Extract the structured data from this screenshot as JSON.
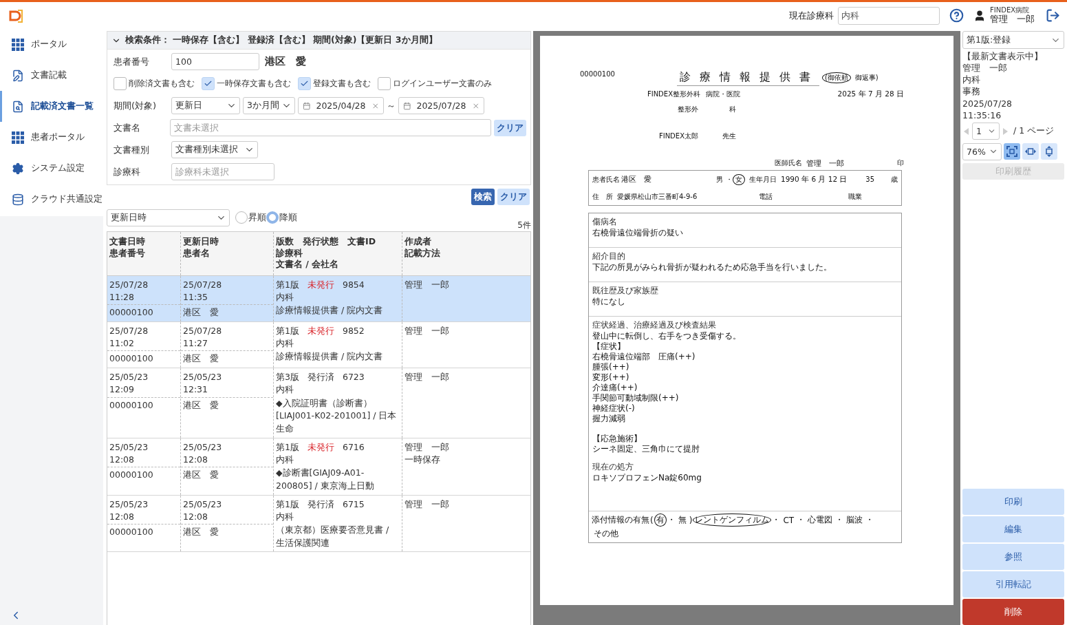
{
  "header": {
    "dept_label": "現在診療科",
    "dept_value": "内科",
    "hospital": "FINDEX病院",
    "user": "管理　一郎"
  },
  "sidebar": {
    "items": [
      {
        "label": "ポータル",
        "selected": false
      },
      {
        "label": "文書記載",
        "selected": false
      },
      {
        "label": "記載済文書一覧",
        "selected": true
      },
      {
        "label": "患者ポータル",
        "selected": false
      },
      {
        "label": "システム設定",
        "selected": false
      },
      {
        "label": "クラウド共通設定",
        "selected": false
      }
    ]
  },
  "search": {
    "expanded": true,
    "summary": "検索条件： 一時保存【含む】 登録済【含む】 期間(対象)【更新日 3か月間】",
    "patient_number_label": "患者番号",
    "patient_number": "100",
    "patient_name": "港区　愛",
    "checkboxes": [
      {
        "label": "削除済文書も含む",
        "checked": false
      },
      {
        "label": "一時保存文書も含む",
        "checked": true
      },
      {
        "label": "登録文書も含む",
        "checked": true
      },
      {
        "label": "ログインユーザー文書のみ",
        "checked": false
      }
    ],
    "period_label": "期間(対象)",
    "period_field": "更新日",
    "period_range": "3か月間",
    "date_from": "2025/04/28",
    "range_separator": "～",
    "date_to": "2025/07/28",
    "doc_name_label": "文書名",
    "doc_name_placeholder": "文書未選択",
    "doc_name_clear": "クリア",
    "doc_type_label": "文書種別",
    "doc_type_value": "文書種別未選択",
    "dept_label": "診療科",
    "dept_placeholder": "診療科未選択"
  },
  "actions": {
    "search": "検索",
    "clear": "クリア"
  },
  "sort": {
    "field": "更新日時",
    "orders": [
      {
        "label": "昇順",
        "selected": false
      },
      {
        "label": "降順",
        "selected": true
      }
    ],
    "count": "5件"
  },
  "table": {
    "columns": [
      [
        "文書日時",
        "患者番号"
      ],
      [
        "更新日時",
        "患者名"
      ],
      [
        "版数　発行状態　文書ID",
        "診療科",
        "文書名 / 会社名"
      ],
      [
        "作成者",
        "記載方法"
      ]
    ],
    "rows": [
      {
        "selected": true,
        "doc_date": "25/07/28",
        "doc_time": "11:28",
        "patient_number": "00000100",
        "upd_date": "25/07/28",
        "upd_time": "11:35",
        "patient_name": "港区　愛",
        "version": "第1版",
        "status": "未発行",
        "issued": false,
        "doc_id": "9854",
        "dept": "内科",
        "doc_name": "診療情報提供書 / 院内文書",
        "author": "管理　一郎"
      },
      {
        "selected": false,
        "doc_date": "25/07/28",
        "doc_time": "11:02",
        "patient_number": "00000100",
        "upd_date": "25/07/28",
        "upd_time": "11:27",
        "patient_name": "港区　愛",
        "version": "第1版",
        "status": "未発行",
        "issued": false,
        "doc_id": "9852",
        "dept": "内科",
        "doc_name": "診療情報提供書 / 院内文書",
        "author": "管理　一郎"
      },
      {
        "selected": false,
        "doc_date": "25/05/23",
        "doc_time": "12:09",
        "patient_number": "00000100",
        "upd_date": "25/05/23",
        "upd_time": "12:31",
        "patient_name": "港区　愛",
        "version": "第3版",
        "status": "発行済",
        "issued": true,
        "doc_id": "6723",
        "dept": "内科",
        "doc_name": "◆入院証明書（診断書）[LIAJ001-K02-201001] / 日本生命",
        "author": "管理　一郎"
      },
      {
        "selected": false,
        "doc_date": "25/05/23",
        "doc_time": "12:08",
        "patient_number": "00000100",
        "upd_date": "25/05/23",
        "upd_time": "12:08",
        "patient_name": "港区　愛",
        "version": "第1版",
        "status": "未発行",
        "issued": false,
        "doc_id": "6716",
        "dept": "内科",
        "doc_name": "◆診断書[GIAJ09-A01-200805] / 東京海上日動",
        "author": "管理　一郎",
        "method": "一時保存"
      },
      {
        "selected": false,
        "doc_date": "25/05/23",
        "doc_time": "12:08",
        "patient_number": "00000100",
        "upd_date": "25/05/23",
        "upd_time": "12:08",
        "patient_name": "港区　愛",
        "version": "第1版",
        "status": "発行済",
        "issued": true,
        "doc_id": "6715",
        "dept": "内科",
        "doc_name": "（東京都）医療要否意見書 / 生活保護関連",
        "author": "管理　一郎"
      }
    ]
  },
  "document": {
    "patient_number": "00000100",
    "title": "診療情報提供書",
    "request_types": [
      {
        "label": "(御依頼",
        "selected": true
      },
      {
        "label": "御返事)",
        "selected": false
      }
    ],
    "hospital": "FINDEX整形外科",
    "hospital_suffix": "病院・医院",
    "department": "整形外",
    "department_suffix": "科",
    "doctor": "FINDEX太郎",
    "doctor_suffix": "先生",
    "date": "2025 年 7 月 28 日",
    "physician_label": "医師氏名",
    "physician": "管理　一郎",
    "seal": "印",
    "patient": {
      "name_label": "患者氏名",
      "name": "港区　愛",
      "sexes": [
        {
          "label": "男",
          "selected": false
        },
        {
          "label": "女",
          "selected": true
        }
      ],
      "sex_separator": "・",
      "birth_label": "生年月日",
      "birth": "1990 年 6 月 12 日",
      "age": "35",
      "age_unit": "歳",
      "address_label": "住　所",
      "address": "愛媛県松山市三番町4-9-6",
      "phone_label": "電話",
      "job_label": "職業"
    },
    "boxes": [
      {
        "blocks": [
          {
            "label": "傷病名",
            "body": "右橈骨遠位端骨折の疑い"
          }
        ]
      },
      {
        "blocks": [
          {
            "label": "紹介目的",
            "body": "下記の所見がみられ骨折が疑われるため応急手当を行いました。"
          }
        ]
      },
      {
        "blocks": [
          {
            "label": "既往歴及び家族歴",
            "body": "特になし"
          }
        ]
      },
      {
        "blocks": [
          {
            "label": "症状経過、治療経過及び検査結果",
            "paragraphs": [
              [
                "登山中に転倒し、右手をつき受傷する。",
                "【症状】",
                "右橈骨遠位端部　圧痛(++)",
                "腫張(++)",
                "変形(++)",
                "介達痛(++)",
                "手関節可動域制限(++)",
                "神経症状(-)",
                "握力減弱"
              ],
              [
                "【応急施術】",
                "シーネ固定、三角巾にて提肘"
              ]
            ]
          },
          {
            "label": "現在の処方",
            "body": "ロキソプロフェンNa錠60mg"
          }
        ]
      }
    ],
    "attachments": {
      "label": "添付情報の有無",
      "open": "(",
      "close": ")",
      "separator": "・",
      "presence": [
        {
          "label": "有",
          "selected": true
        },
        {
          "label": "無",
          "selected": false
        }
      ],
      "items": [
        {
          "label": "レントゲンフィルム",
          "selected": true
        },
        {
          "label": "CT",
          "selected": false
        },
        {
          "label": "心電図",
          "selected": false
        },
        {
          "label": "脳波",
          "selected": false
        },
        {
          "label": "その他",
          "selected": false
        }
      ]
    }
  },
  "viewer_tools": {
    "version": "第1版:登録",
    "info": [
      "【最新文書表示中】",
      "管理　一郎",
      "内科",
      "事務",
      "2025/07/28",
      "11:35:16"
    ],
    "page": "1",
    "page_total": "/ 1 ページ",
    "zoom": "76%",
    "fit_modes": [
      {
        "selected": true
      },
      {
        "selected": false
      },
      {
        "selected": false
      }
    ],
    "print_history": {
      "label": "印刷履歴",
      "disabled": true
    },
    "buttons": [
      {
        "label": "印刷",
        "kind": "normal"
      },
      {
        "label": "編集",
        "kind": "normal"
      },
      {
        "label": "参照",
        "kind": "normal"
      },
      {
        "label": "引用転記",
        "kind": "normal"
      },
      {
        "label": "削除",
        "kind": "danger"
      }
    ]
  }
}
